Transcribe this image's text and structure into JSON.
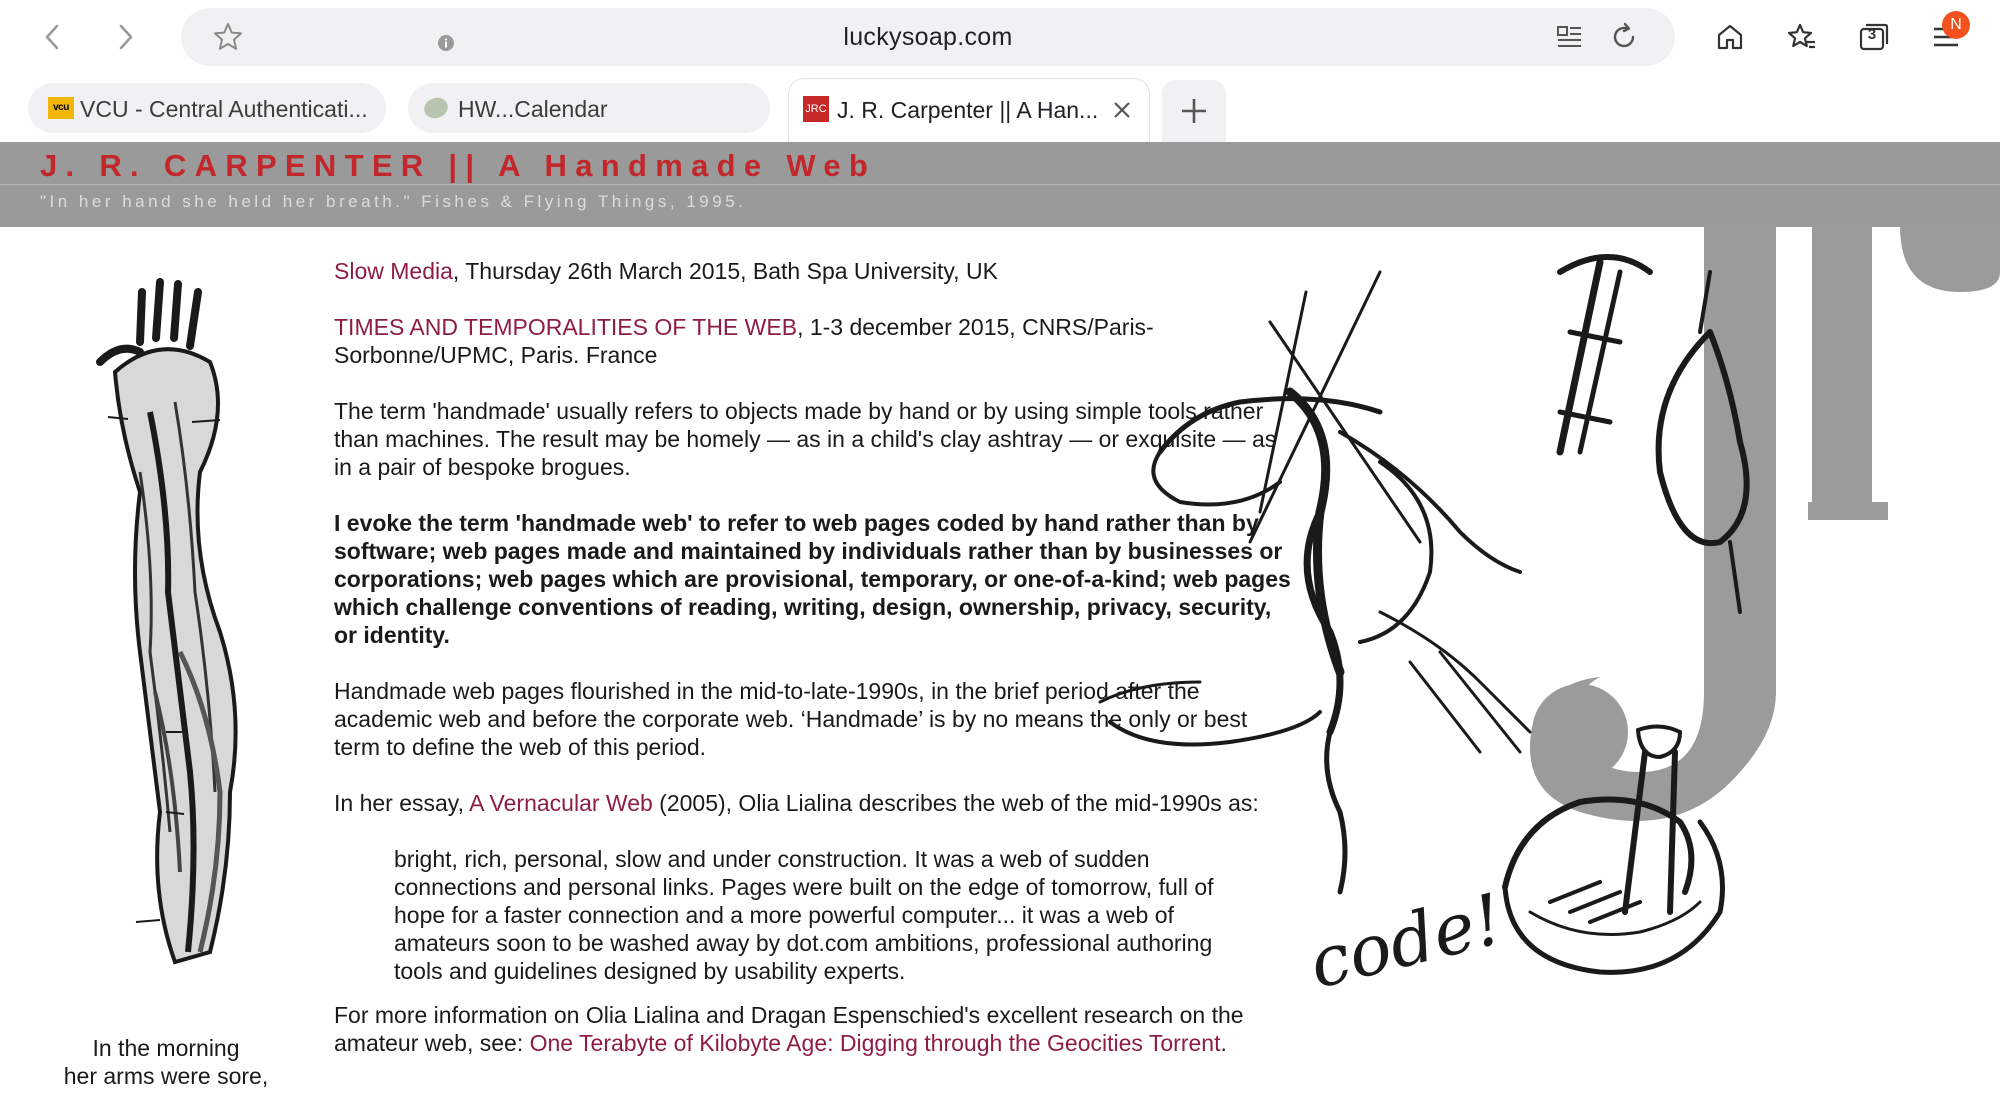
{
  "browser": {
    "url": "luckysoap.com",
    "tab_count": "3",
    "notification_badge": "N",
    "tabs": [
      {
        "title": "VCU - Central Authenticati...",
        "favicon_text": "vcu"
      },
      {
        "title": "HW...Calendar"
      },
      {
        "title": "J. R. Carpenter || A Han...",
        "favicon_text": "JRC"
      }
    ]
  },
  "site": {
    "title": "J. R. CARPENTER || A Handmade Web",
    "tagline": "\"In her hand she held her breath.\" Fishes & Flying Things, 1995.",
    "title_color": "#c2282b",
    "header_color": "#9a9a9a",
    "link_color": "#8e1c47"
  },
  "content": {
    "p1_link": "Slow Media",
    "p1_rest": ", Thursday 26th March 2015, Bath Spa University, UK",
    "p2_link": "TIMES AND TEMPORALITIES OF THE WEB",
    "p2_rest": ", 1-3 december 2015, CNRS/Paris-Sorbonne/UPMC, Paris. France",
    "p3": "The term 'handmade' usually refers to objects made by hand or by using simple tools rather than machines. The result may be homely — as in a child's clay ashtray — or exquisite — as in a pair of bespoke brogues.",
    "p4": "I evoke the term 'handmade web' to refer to web pages coded by hand rather than by software; web pages made and maintained by individuals rather than by businesses or corporations; web pages which are provisional, temporary, or one-of-a-kind; web pages which challenge conventions of reading, writing, design, ownership, privacy, security, or identity.",
    "p5": "Handmade web pages flourished in the mid-to-late-1990s, in the brief period after the academic web and before the corporate web. ‘Handmade’ is by no means the only or best term to define the web of this period.",
    "p6_before": "In her essay, ",
    "p6_link": "A Vernacular Web",
    "p6_after": " (2005), Olia Lialina describes the web of the mid-1990s as:",
    "quote": "bright, rich, personal, slow and under construction. It was a web of sudden connections and personal links. Pages were built on the edge of tomorrow, full of hope for a faster connection and a more powerful computer... it was a web of amateurs soon to be washed away by dot.com ambitions, professional authoring tools and guidelines designed by usability experts.",
    "p7_before": "For more information on Olia Lialina and Dragan Espenschied's excellent research on the amateur web, see: ",
    "p7_link": "One Terabyte of Kilobyte Age: Digging through the Geocities Torrent",
    "p7_after": "."
  },
  "sidebar": {
    "caption_line1": "In the morning",
    "caption_line2": "her arms were sore,"
  },
  "illustration": {
    "handwritten_text": "code!"
  }
}
